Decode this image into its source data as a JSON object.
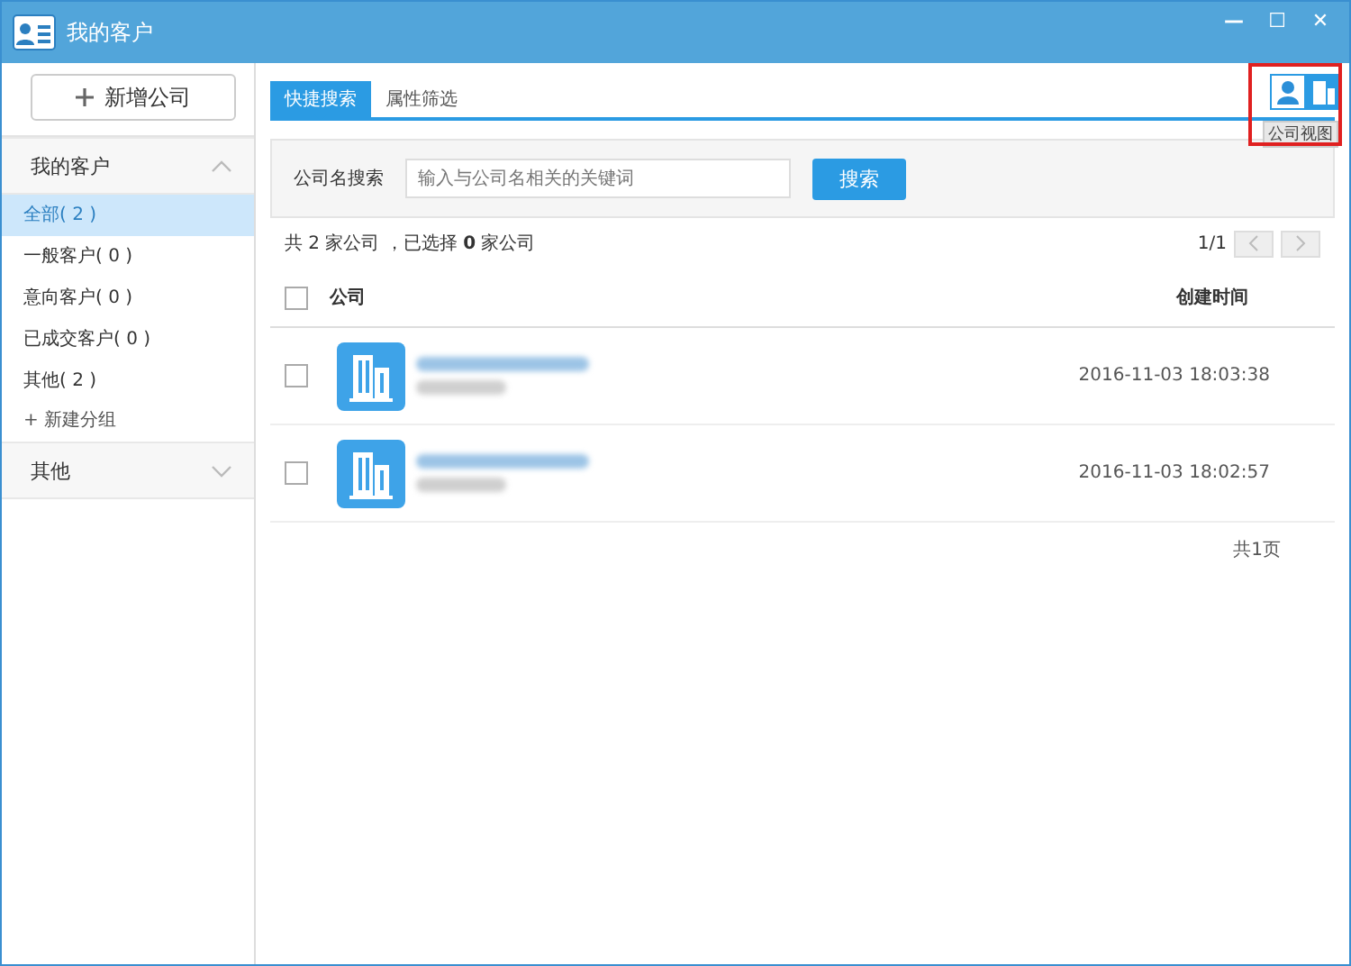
{
  "window": {
    "title": "我的客户",
    "controls": [
      "—",
      "☐",
      "✕"
    ]
  },
  "sidebar": {
    "add_button": "新增公司",
    "sections": [
      {
        "title": "我的客户",
        "expanded": true,
        "items": [
          {
            "label": "全部( 2 )",
            "selected": true
          },
          {
            "label": "一般客户( 0 )",
            "selected": false
          },
          {
            "label": "意向客户( 0 )",
            "selected": false
          },
          {
            "label": "已成交客户( 0 )",
            "selected": false
          },
          {
            "label": "其他( 2 )",
            "selected": false
          }
        ],
        "add_group": "+ 新建分组"
      },
      {
        "title": "其他",
        "expanded": false
      }
    ]
  },
  "tabs": [
    {
      "label": "快捷搜索",
      "selected": true
    },
    {
      "label": "属性筛选",
      "selected": false
    }
  ],
  "view_toggle": [
    {
      "kind": "person",
      "selected": false
    },
    {
      "kind": "company",
      "selected": true
    }
  ],
  "tooltip": "公司视图",
  "search": {
    "label": "公司名搜索",
    "placeholder": "输入与公司名相关的关键词",
    "button": "搜索"
  },
  "summary": {
    "text": "共 2 家公司 ，已选择 **0** 家公司",
    "page": "1/1"
  },
  "table": {
    "columns": [
      "公司",
      "创建时间"
    ],
    "all_checked": false,
    "rows": [
      {
        "checked": false,
        "created": "2016-11-03 18:03:38"
      },
      {
        "checked": false,
        "created": "2016-11-03 18:02:57"
      }
    ]
  },
  "footer": "共1页"
}
